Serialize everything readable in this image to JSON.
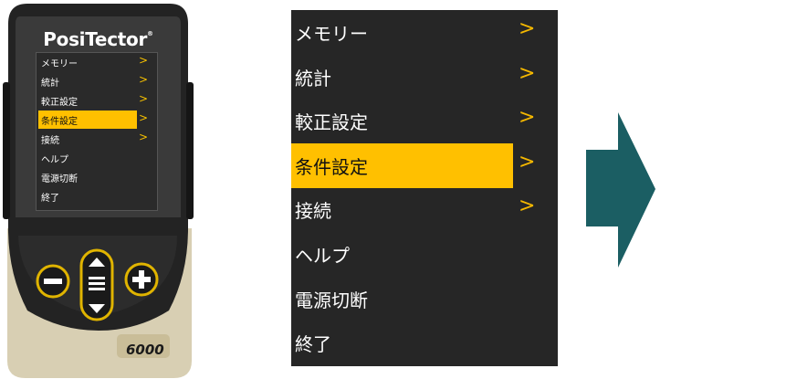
{
  "device": {
    "brand": "PosiTector",
    "brand_mark": "®",
    "model": "6000",
    "screen_items": [
      {
        "label": "メモリー",
        "arrow": ">",
        "selected": false
      },
      {
        "label": "統計",
        "arrow": ">",
        "selected": false
      },
      {
        "label": "較正設定",
        "arrow": ">",
        "selected": false
      },
      {
        "label": "条件設定",
        "arrow": ">",
        "selected": true
      },
      {
        "label": "接続",
        "arrow": ">",
        "selected": false
      },
      {
        "label": "ヘルプ",
        "arrow": "",
        "selected": false
      },
      {
        "label": "電源切断",
        "arrow": "",
        "selected": false
      },
      {
        "label": "終了",
        "arrow": "",
        "selected": false
      }
    ]
  },
  "menu": {
    "items": [
      {
        "label": "メモリー",
        "arrow": ">",
        "selected": false
      },
      {
        "label": "統計",
        "arrow": ">",
        "selected": false
      },
      {
        "label": "較正設定",
        "arrow": ">",
        "selected": false
      },
      {
        "label": "条件設定",
        "arrow": ">",
        "selected": true
      },
      {
        "label": "接続",
        "arrow": ">",
        "selected": false
      },
      {
        "label": "ヘルプ",
        "arrow": "",
        "selected": false
      },
      {
        "label": "電源切断",
        "arrow": "",
        "selected": false
      },
      {
        "label": "終了",
        "arrow": "",
        "selected": false
      }
    ]
  },
  "colors": {
    "highlight": "#ffc000",
    "arrow_accent": "#f5b800",
    "menu_bg": "#262626",
    "next_arrow": "#1b5e63"
  }
}
